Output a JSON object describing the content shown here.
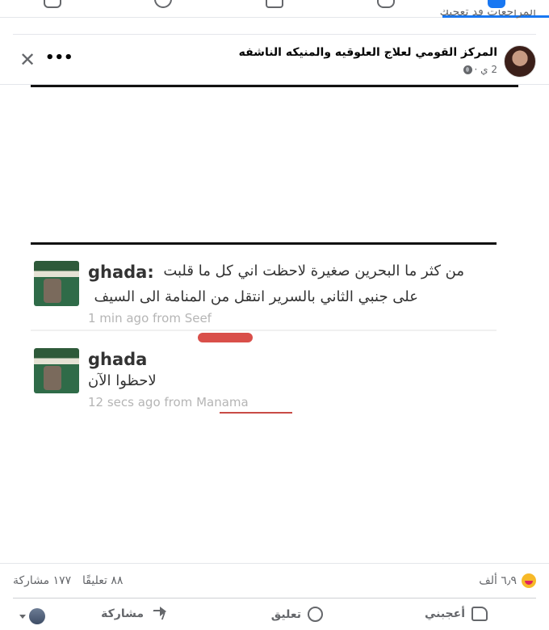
{
  "top_nav": {
    "truncated_text": "المراجعات قد تعجبك",
    "icons": [
      "home-icon",
      "video-icon",
      "marketplace-icon",
      "people-icon",
      "facebook-icon"
    ]
  },
  "post": {
    "page_name": "المركز القومي لعلاج العلوقيه والمنيكه الناشفه",
    "time": "2 ي ·",
    "privacy_icon": "globe-icon"
  },
  "image_content": {
    "tweet1": {
      "name": "ghada:",
      "line1": "من كثر ما البحرين صغيرة لاحظت اني كل ما قلبت",
      "line2": "على جنبي الثاني بالسرير انتقل من المنامة الى السيف",
      "time": "1 min ago from Seef"
    },
    "tweet2": {
      "name": "ghada",
      "line1": "لاحظوا الآن",
      "time": "12 secs ago from Manama"
    }
  },
  "stats": {
    "reactions": "٦٫٩ ألف",
    "comments": "٨٨ تعليقًا",
    "shares": "١٧٧ مشاركة"
  },
  "actions": {
    "like": "أعجبني",
    "comment": "تعليق",
    "share": "مشاركة"
  },
  "colors": {
    "accent": "#1877f2",
    "text_secondary": "#65676b"
  }
}
